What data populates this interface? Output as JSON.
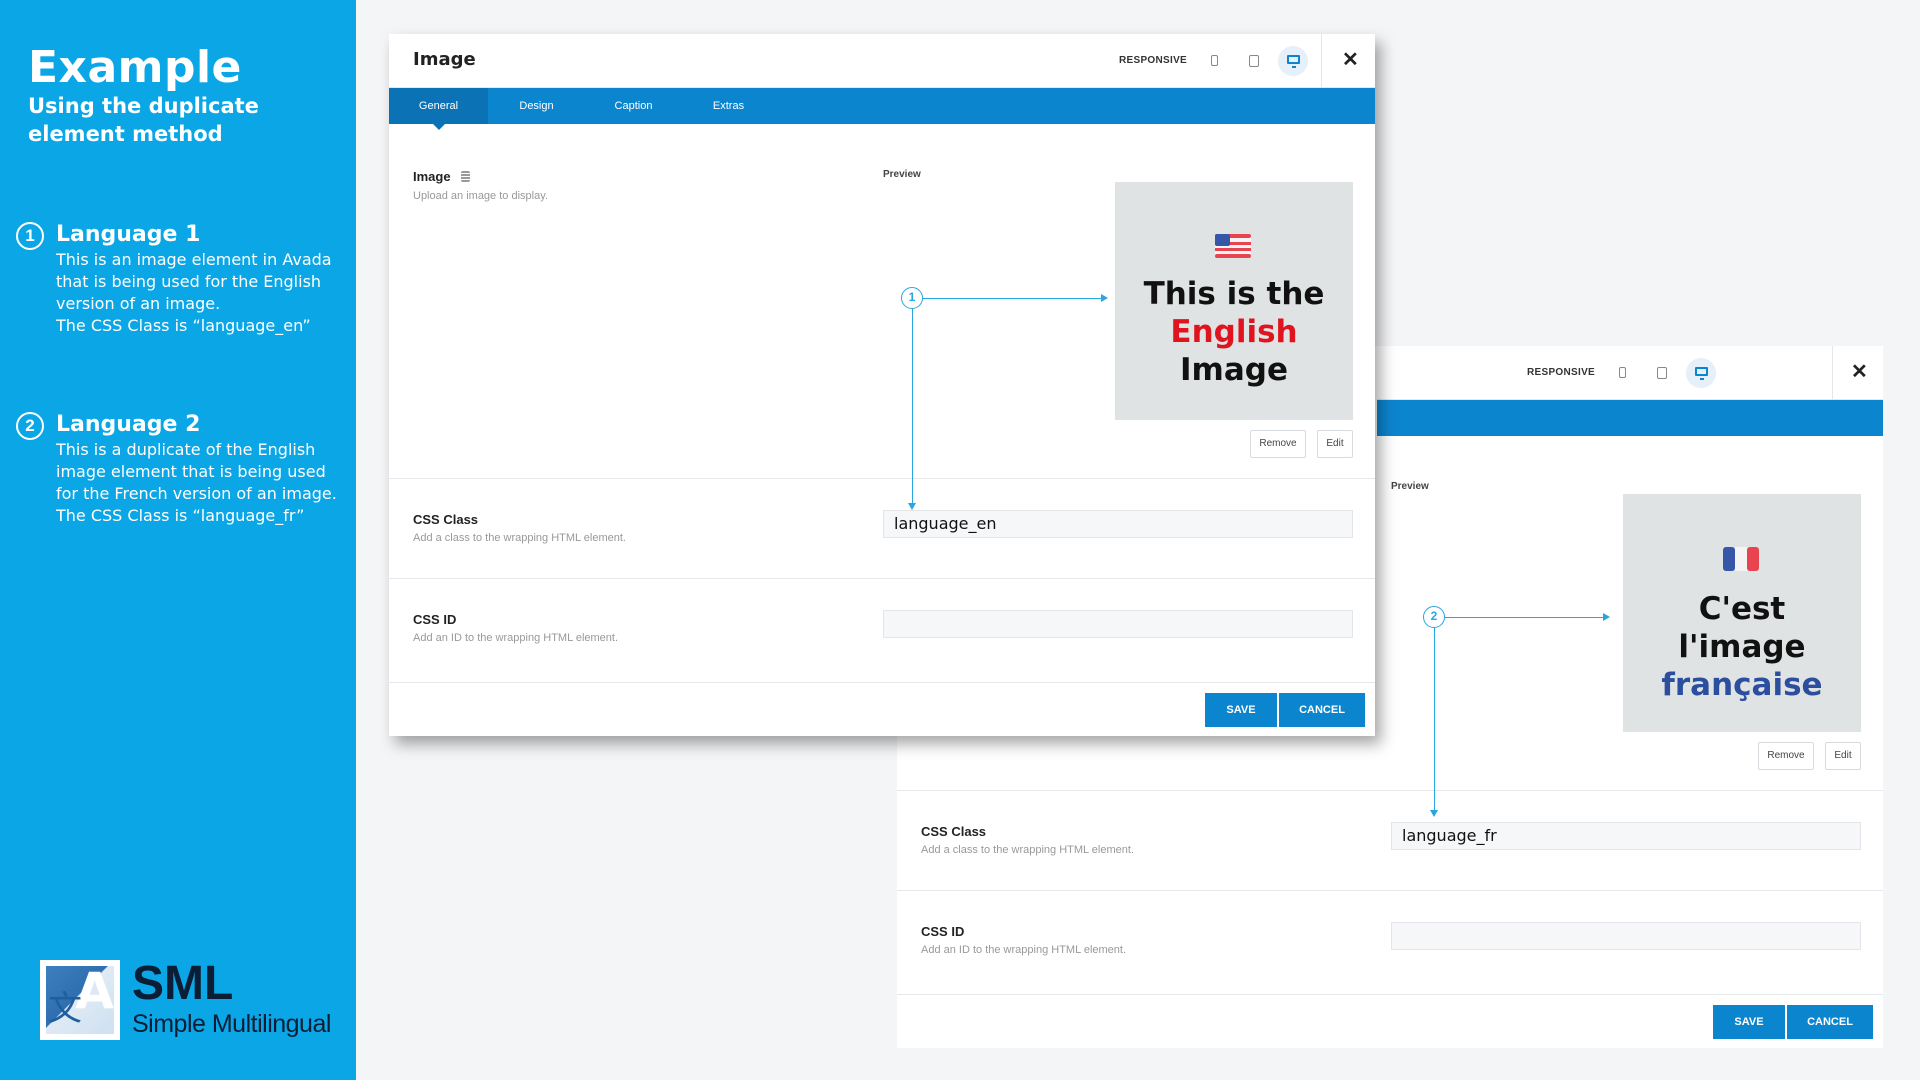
{
  "sidebar": {
    "title": "Example",
    "subtitle": "Using the duplicate element method",
    "steps": [
      {
        "num": "1",
        "title": "Language 1",
        "lines": [
          "This is an image element in Avada",
          "that is being used for the English",
          "version of an image.",
          "The CSS Class is “language_en”"
        ]
      },
      {
        "num": "2",
        "title": "Language 2",
        "lines": [
          "This is a duplicate of the English",
          "image element that is being used",
          "for the French version of an image.",
          "The CSS Class is “language_fr”"
        ]
      }
    ],
    "logo": {
      "name": "SML",
      "tagline": "Simple Multilingual",
      "mark_letter": "A",
      "mark_glyph": "文"
    }
  },
  "dialog_en": {
    "title": "Image",
    "responsive_label": "RESPONSIVE",
    "tabs": [
      "General",
      "Design",
      "Caption",
      "Extras"
    ],
    "image_label": "Image",
    "image_help": "Upload an image to display.",
    "preview_label": "Preview",
    "preview_lines": [
      "This is the",
      "English",
      "Image"
    ],
    "remove_label": "Remove",
    "edit_label": "Edit",
    "css_class_label": "CSS Class",
    "css_class_help": "Add a class to the wrapping HTML element.",
    "css_class_value": "language_en",
    "css_id_label": "CSS ID",
    "css_id_help": "Add an ID to the wrapping HTML element.",
    "css_id_value": "",
    "save_label": "SAVE",
    "cancel_label": "CANCEL",
    "annotation": "1"
  },
  "dialog_fr": {
    "responsive_label": "RESPONSIVE",
    "preview_label": "Preview",
    "preview_lines": [
      "C'est",
      "l'image",
      "française"
    ],
    "remove_label": "Remove",
    "edit_label": "Edit",
    "css_class_label": "CSS Class",
    "css_class_help": "Add a class to the wrapping HTML element.",
    "css_class_value": "language_fr",
    "css_id_label": "CSS ID",
    "css_id_help": "Add an ID to the wrapping HTML element.",
    "css_id_value": "",
    "save_label": "SAVE",
    "cancel_label": "CANCEL",
    "annotation": "2"
  },
  "icons": {
    "close": "close-icon",
    "mobile": "mobile-icon",
    "tablet": "tablet-icon",
    "desktop": "desktop-icon",
    "database": "database-icon"
  },
  "colors": {
    "sidebar_bg": "#0aa6e6",
    "accent": "#0c85cf",
    "annotation": "#28a6e0",
    "english_red": "#e0141e",
    "french_blue": "#2b4e9e"
  }
}
